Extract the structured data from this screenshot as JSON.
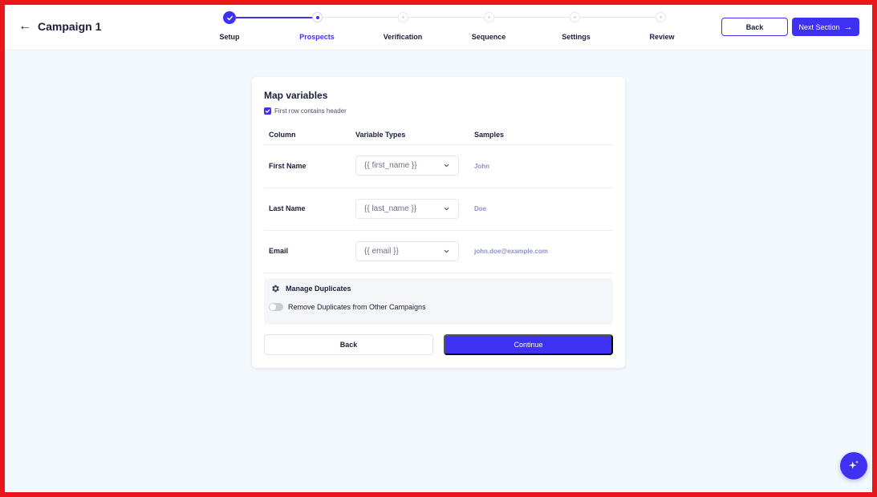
{
  "header": {
    "back_icon": "arrow-left-icon",
    "title": "Campaign 1",
    "steps": [
      {
        "label": "Setup",
        "state": "done"
      },
      {
        "label": "Prospects",
        "state": "active"
      },
      {
        "label": "Verification",
        "state": "pending"
      },
      {
        "label": "Sequence",
        "state": "pending"
      },
      {
        "label": "Settings",
        "state": "pending"
      },
      {
        "label": "Review",
        "state": "pending"
      }
    ],
    "back_label": "Back",
    "next_label": "Next Section",
    "next_icon": "arrow-right-icon"
  },
  "card": {
    "title": "Map variables",
    "header_checkbox_label": "First row contains header",
    "header_checkbox_checked": true,
    "columns": {
      "column": "Column",
      "types": "Variable Types",
      "samples": "Samples"
    },
    "rows": [
      {
        "column": "First Name",
        "variable": "{{ first_name }}",
        "sample": "John"
      },
      {
        "column": "Last Name",
        "variable": "{{ last_name }}",
        "sample": "Doe"
      },
      {
        "column": "Email",
        "variable": "{{ email }}",
        "sample": "john.doe@example.com"
      }
    ],
    "duplicates": {
      "icon": "gear-icon",
      "title": "Manage Duplicates",
      "toggle_label": "Remove Duplicates from Other Campaigns",
      "toggle_on": false
    },
    "back_label": "Back",
    "continue_label": "Continue"
  },
  "fab_icon": "sparkle-icon",
  "colors": {
    "accent": "#3e31f2",
    "frame": "#e8171c",
    "background": "#f3f8fc"
  }
}
